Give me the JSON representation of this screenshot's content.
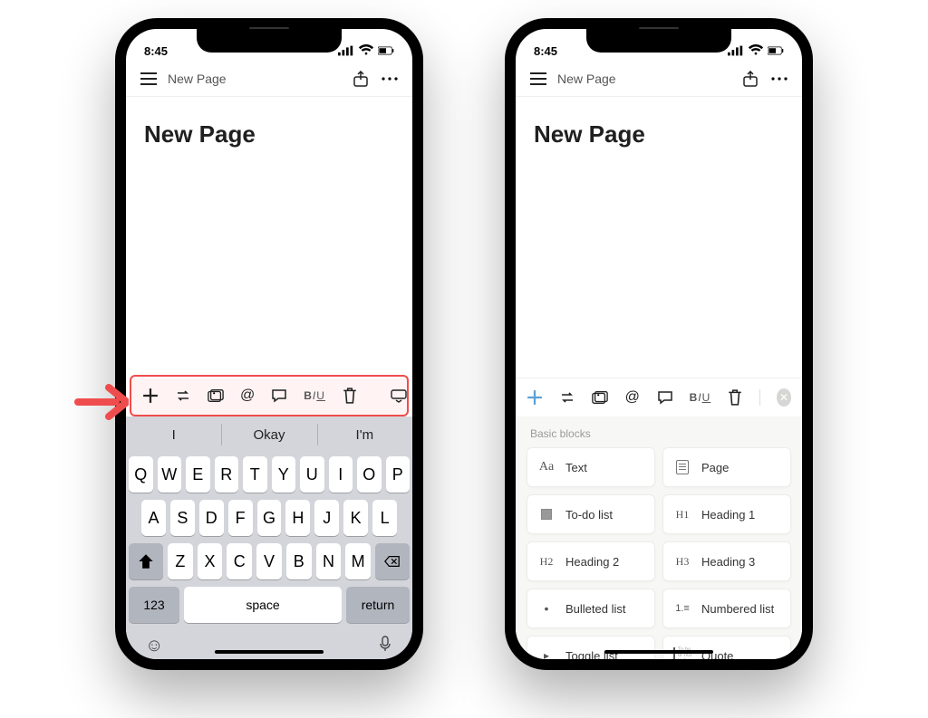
{
  "status": {
    "time": "8:45"
  },
  "header": {
    "title": "New Page"
  },
  "page": {
    "title": "New Page"
  },
  "toolbar": {
    "biu": "BIU"
  },
  "keyboard": {
    "suggestions": [
      "I",
      "Okay",
      "I'm"
    ],
    "row1": [
      "Q",
      "W",
      "E",
      "R",
      "T",
      "Y",
      "U",
      "I",
      "O",
      "P"
    ],
    "row2": [
      "A",
      "S",
      "D",
      "F",
      "G",
      "H",
      "J",
      "K",
      "L"
    ],
    "row3": [
      "Z",
      "X",
      "C",
      "V",
      "B",
      "N",
      "M"
    ],
    "numkey": "123",
    "space": "space",
    "return": "return"
  },
  "blocks": {
    "section_label": "Basic blocks",
    "items": [
      {
        "label": "Text",
        "icon": "aa"
      },
      {
        "label": "Page",
        "icon": "page"
      },
      {
        "label": "To-do list",
        "icon": "todo"
      },
      {
        "label": "Heading 1",
        "icon": "h1"
      },
      {
        "label": "Heading 2",
        "icon": "h2"
      },
      {
        "label": "Heading 3",
        "icon": "h3"
      },
      {
        "label": "Bulleted list",
        "icon": "bullet"
      },
      {
        "label": "Numbered list",
        "icon": "numlist"
      },
      {
        "label": "Toggle list",
        "icon": "toggle"
      },
      {
        "label": "Quote",
        "icon": "quote"
      }
    ]
  }
}
